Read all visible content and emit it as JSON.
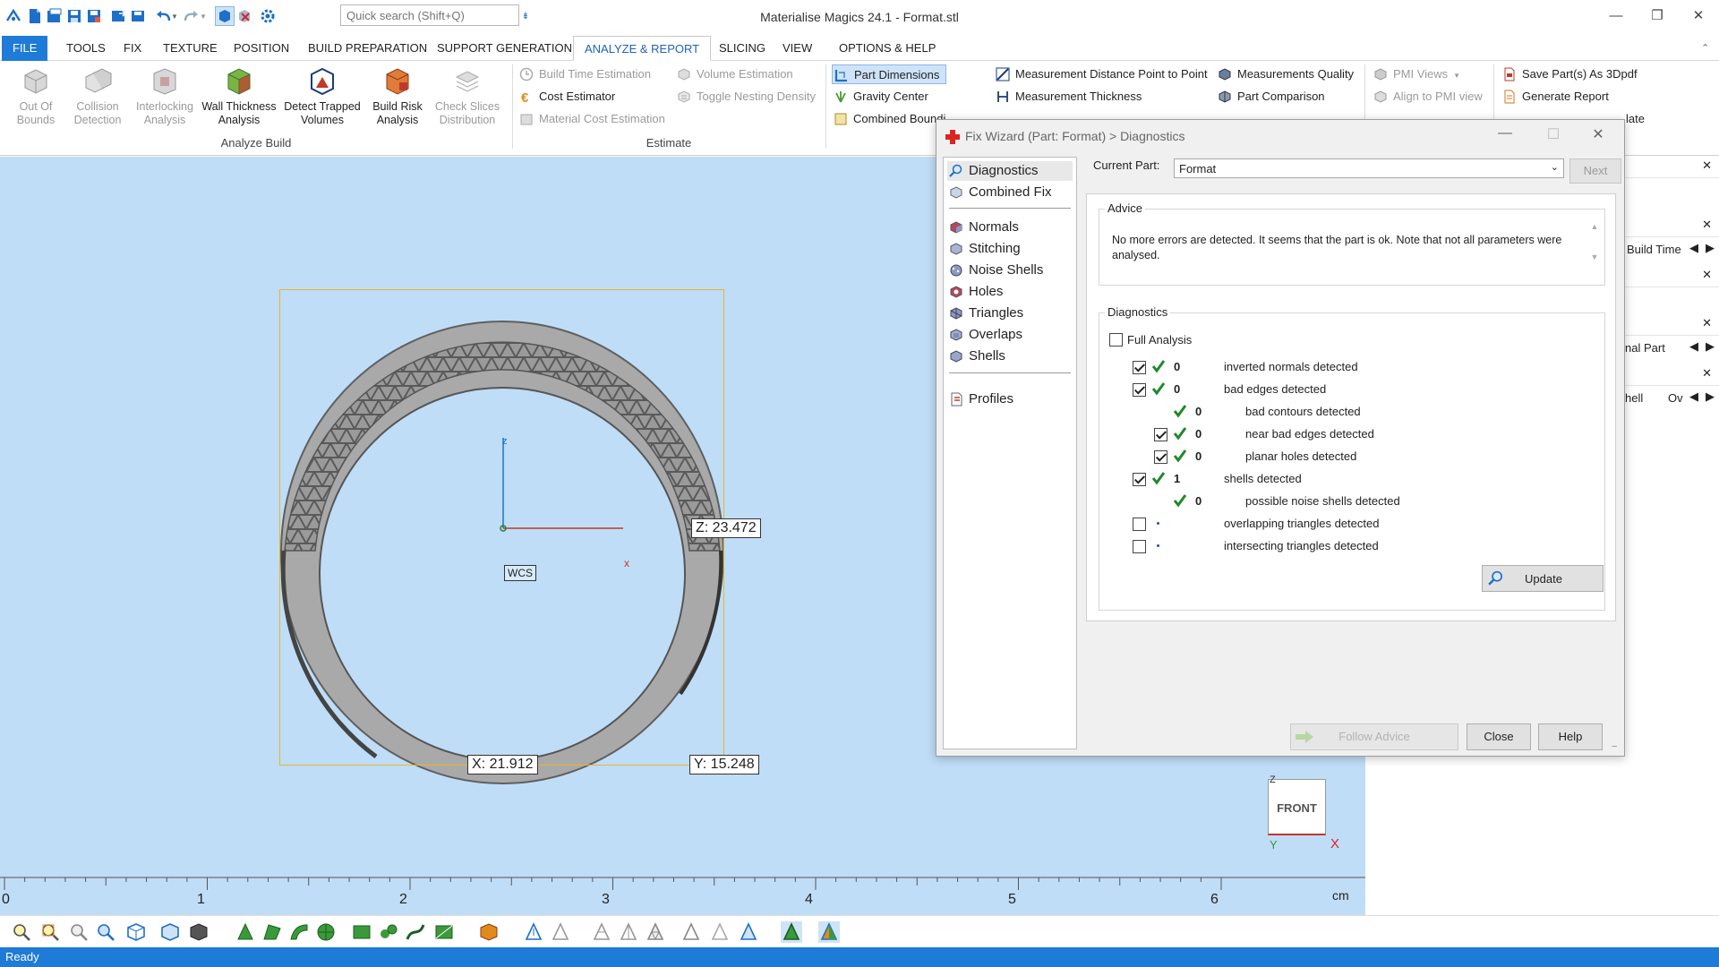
{
  "window": {
    "title": "Materialise Magics 24.1 - Format.stl",
    "quick_search_placeholder": "Quick search (Shift+Q)"
  },
  "menu": {
    "tabs": [
      "FILE",
      "TOOLS",
      "FIX",
      "TEXTURE",
      "POSITION",
      "BUILD PREPARATION",
      "SUPPORT GENERATION",
      "ANALYZE & REPORT",
      "SLICING",
      "VIEW",
      "OPTIONS & HELP"
    ],
    "active": "ANALYZE & REPORT"
  },
  "ribbon": {
    "analyze_build": {
      "label": "Analyze Build",
      "buttons": [
        {
          "l1": "Out Of",
          "l2": "Bounds"
        },
        {
          "l1": "Collision",
          "l2": "Detection"
        },
        {
          "l1": "Interlocking",
          "l2": "Analysis"
        },
        {
          "l1": "Wall Thickness",
          "l2": "Analysis"
        },
        {
          "l1": "Detect Trapped",
          "l2": "Volumes"
        },
        {
          "l1": "Build Risk",
          "l2": "Analysis"
        },
        {
          "l1": "Check Slices",
          "l2": "Distribution"
        }
      ]
    },
    "estimate": {
      "label": "Estimate",
      "items": [
        "Build Time Estimation",
        "Cost Estimator",
        "Material Cost Estimation",
        "Volume Estimation",
        "Toggle Nesting Density"
      ]
    },
    "measure": {
      "items": [
        "Part Dimensions",
        "Gravity Center",
        "Combined Boundi",
        "Measurement Distance Point to Point",
        "Measurement Thickness",
        "Measurements Quality",
        "Part Comparison"
      ]
    },
    "pmi": {
      "items": [
        "PMI Views",
        "Align to PMI view"
      ]
    },
    "report": {
      "items": [
        "Save Part(s) As 3Dpdf",
        "Generate Report",
        "late"
      ]
    }
  },
  "viewport": {
    "dims": {
      "z": "Z: 23.472",
      "x": "X: 21.912",
      "y": "Y: 15.248"
    },
    "wcs_label": "WCS",
    "axis_z": "z",
    "axis_x": "x",
    "viewcube": {
      "face": "FRONT",
      "z": "Z",
      "y": "Y",
      "x": "X"
    },
    "ruler": {
      "ticks": [
        "0",
        "1",
        "2",
        "3",
        "4",
        "5",
        "6"
      ],
      "unit": "cm"
    }
  },
  "right_panel": {
    "rows": [
      "Build Time",
      "nal Part",
      "hell",
      "Ov"
    ]
  },
  "dialog": {
    "title": "Fix Wizard (Part: Format) > Diagnostics",
    "nav": {
      "top": [
        "Diagnostics",
        "Combined Fix"
      ],
      "mid": [
        "Normals",
        "Stitching",
        "Noise Shells",
        "Holes",
        "Triangles",
        "Overlaps",
        "Shells"
      ],
      "bottom": [
        "Profiles"
      ]
    },
    "current_part_label": "Current Part:",
    "current_part_value": "Format",
    "next_label": "Next",
    "advice": {
      "label": "Advice",
      "text": "No more errors are detected. It seems that the part is ok. Note that not all parameters were analysed."
    },
    "diagnostics": {
      "label": "Diagnostics",
      "full_analysis_label": "Full Analysis",
      "rows": [
        {
          "count": "0",
          "text": "inverted normals detected"
        },
        {
          "count": "0",
          "text": "bad edges detected"
        },
        {
          "count": "0",
          "text": "bad contours detected"
        },
        {
          "count": "0",
          "text": "near bad edges detected"
        },
        {
          "count": "0",
          "text": "planar holes detected"
        },
        {
          "count": "1",
          "text": "shells detected"
        },
        {
          "count": "0",
          "text": "possible noise shells detected"
        },
        {
          "count": "",
          "text": "overlapping triangles detected"
        },
        {
          "count": "",
          "text": "intersecting triangles detected"
        }
      ],
      "update_label": "Update"
    },
    "buttons": {
      "follow": "Follow Advice",
      "close": "Close",
      "help": "Help"
    }
  },
  "status": {
    "text": "Ready"
  },
  "colors": {
    "accent": "#1e7bd8",
    "viewport_bg": "#bfddf7",
    "bbox": "#e8b62a",
    "tick_green": "#1f8a2a"
  }
}
